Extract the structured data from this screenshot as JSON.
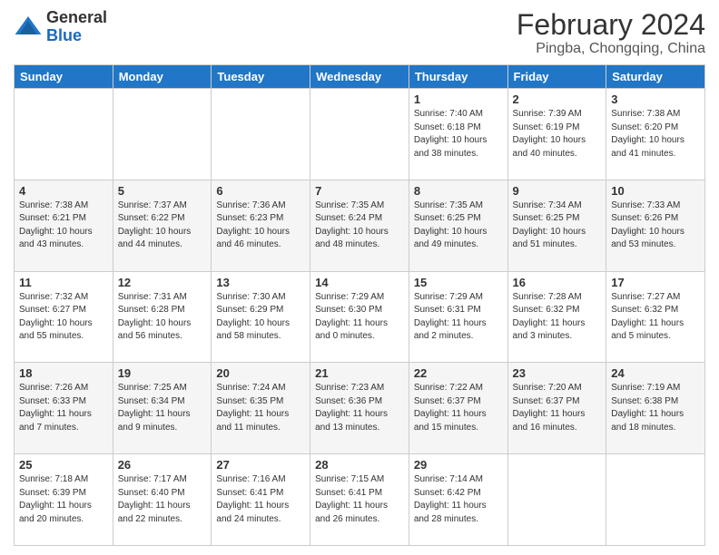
{
  "logo": {
    "general": "General",
    "blue": "Blue"
  },
  "header": {
    "title": "February 2024",
    "subtitle": "Pingba, Chongqing, China"
  },
  "weekdays": [
    "Sunday",
    "Monday",
    "Tuesday",
    "Wednesday",
    "Thursday",
    "Friday",
    "Saturday"
  ],
  "weeks": [
    [
      {
        "day": "",
        "info": ""
      },
      {
        "day": "",
        "info": ""
      },
      {
        "day": "",
        "info": ""
      },
      {
        "day": "",
        "info": ""
      },
      {
        "day": "1",
        "info": "Sunrise: 7:40 AM\nSunset: 6:18 PM\nDaylight: 10 hours\nand 38 minutes."
      },
      {
        "day": "2",
        "info": "Sunrise: 7:39 AM\nSunset: 6:19 PM\nDaylight: 10 hours\nand 40 minutes."
      },
      {
        "day": "3",
        "info": "Sunrise: 7:38 AM\nSunset: 6:20 PM\nDaylight: 10 hours\nand 41 minutes."
      }
    ],
    [
      {
        "day": "4",
        "info": "Sunrise: 7:38 AM\nSunset: 6:21 PM\nDaylight: 10 hours\nand 43 minutes."
      },
      {
        "day": "5",
        "info": "Sunrise: 7:37 AM\nSunset: 6:22 PM\nDaylight: 10 hours\nand 44 minutes."
      },
      {
        "day": "6",
        "info": "Sunrise: 7:36 AM\nSunset: 6:23 PM\nDaylight: 10 hours\nand 46 minutes."
      },
      {
        "day": "7",
        "info": "Sunrise: 7:35 AM\nSunset: 6:24 PM\nDaylight: 10 hours\nand 48 minutes."
      },
      {
        "day": "8",
        "info": "Sunrise: 7:35 AM\nSunset: 6:25 PM\nDaylight: 10 hours\nand 49 minutes."
      },
      {
        "day": "9",
        "info": "Sunrise: 7:34 AM\nSunset: 6:25 PM\nDaylight: 10 hours\nand 51 minutes."
      },
      {
        "day": "10",
        "info": "Sunrise: 7:33 AM\nSunset: 6:26 PM\nDaylight: 10 hours\nand 53 minutes."
      }
    ],
    [
      {
        "day": "11",
        "info": "Sunrise: 7:32 AM\nSunset: 6:27 PM\nDaylight: 10 hours\nand 55 minutes."
      },
      {
        "day": "12",
        "info": "Sunrise: 7:31 AM\nSunset: 6:28 PM\nDaylight: 10 hours\nand 56 minutes."
      },
      {
        "day": "13",
        "info": "Sunrise: 7:30 AM\nSunset: 6:29 PM\nDaylight: 10 hours\nand 58 minutes."
      },
      {
        "day": "14",
        "info": "Sunrise: 7:29 AM\nSunset: 6:30 PM\nDaylight: 11 hours\nand 0 minutes."
      },
      {
        "day": "15",
        "info": "Sunrise: 7:29 AM\nSunset: 6:31 PM\nDaylight: 11 hours\nand 2 minutes."
      },
      {
        "day": "16",
        "info": "Sunrise: 7:28 AM\nSunset: 6:32 PM\nDaylight: 11 hours\nand 3 minutes."
      },
      {
        "day": "17",
        "info": "Sunrise: 7:27 AM\nSunset: 6:32 PM\nDaylight: 11 hours\nand 5 minutes."
      }
    ],
    [
      {
        "day": "18",
        "info": "Sunrise: 7:26 AM\nSunset: 6:33 PM\nDaylight: 11 hours\nand 7 minutes."
      },
      {
        "day": "19",
        "info": "Sunrise: 7:25 AM\nSunset: 6:34 PM\nDaylight: 11 hours\nand 9 minutes."
      },
      {
        "day": "20",
        "info": "Sunrise: 7:24 AM\nSunset: 6:35 PM\nDaylight: 11 hours\nand 11 minutes."
      },
      {
        "day": "21",
        "info": "Sunrise: 7:23 AM\nSunset: 6:36 PM\nDaylight: 11 hours\nand 13 minutes."
      },
      {
        "day": "22",
        "info": "Sunrise: 7:22 AM\nSunset: 6:37 PM\nDaylight: 11 hours\nand 15 minutes."
      },
      {
        "day": "23",
        "info": "Sunrise: 7:20 AM\nSunset: 6:37 PM\nDaylight: 11 hours\nand 16 minutes."
      },
      {
        "day": "24",
        "info": "Sunrise: 7:19 AM\nSunset: 6:38 PM\nDaylight: 11 hours\nand 18 minutes."
      }
    ],
    [
      {
        "day": "25",
        "info": "Sunrise: 7:18 AM\nSunset: 6:39 PM\nDaylight: 11 hours\nand 20 minutes."
      },
      {
        "day": "26",
        "info": "Sunrise: 7:17 AM\nSunset: 6:40 PM\nDaylight: 11 hours\nand 22 minutes."
      },
      {
        "day": "27",
        "info": "Sunrise: 7:16 AM\nSunset: 6:41 PM\nDaylight: 11 hours\nand 24 minutes."
      },
      {
        "day": "28",
        "info": "Sunrise: 7:15 AM\nSunset: 6:41 PM\nDaylight: 11 hours\nand 26 minutes."
      },
      {
        "day": "29",
        "info": "Sunrise: 7:14 AM\nSunset: 6:42 PM\nDaylight: 11 hours\nand 28 minutes."
      },
      {
        "day": "",
        "info": ""
      },
      {
        "day": "",
        "info": ""
      }
    ]
  ]
}
